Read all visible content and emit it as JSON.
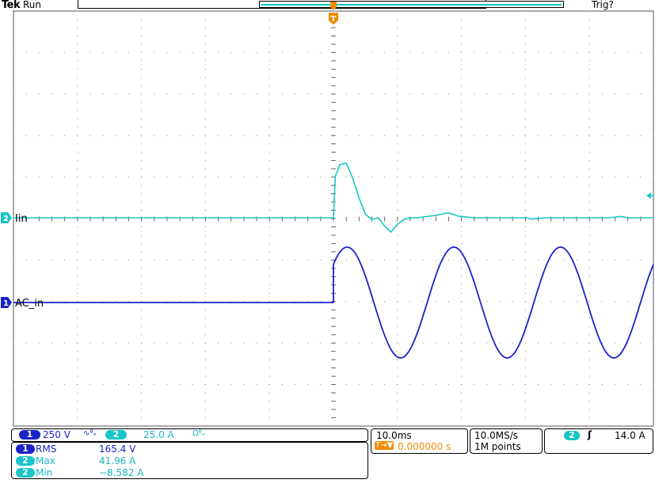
{
  "header": {
    "brand": "Tek",
    "run_state": "Run",
    "trigger_state": "Trig?"
  },
  "trigger_marker_letter": "T",
  "chart_data": {
    "type": "line",
    "title": "",
    "x_unit": "ms",
    "x_range": [
      -50,
      50
    ],
    "trigger_time_ms": 0,
    "grid": true,
    "series": [
      {
        "name": "Iin",
        "channel": 2,
        "color": "#19c5c8",
        "unit": "A",
        "volts_per_div": 25.0,
        "x": [
          -50,
          0,
          0.3,
          1,
          2,
          3,
          4,
          5,
          6,
          7,
          8,
          9,
          10,
          11,
          12,
          13,
          16,
          18,
          19.5,
          22,
          24,
          30,
          31,
          33,
          35,
          43,
          45,
          46,
          48,
          50
        ],
        "y": [
          0,
          0,
          25,
          32,
          33,
          24,
          12,
          2,
          -1,
          0,
          -5,
          -8.58,
          -4,
          -1,
          0,
          0,
          1.5,
          3,
          1,
          0,
          0,
          0,
          -0.8,
          0,
          0,
          0,
          0.8,
          0,
          0,
          0
        ]
      },
      {
        "name": "AC_in",
        "channel": 1,
        "color": "#1a23c8",
        "unit": "V",
        "volts_per_div": 250,
        "x": [
          -50,
          0,
          0,
          50
        ],
        "y": [
          0,
          0,
          240,
          null
        ],
        "note_func": "sine after trigger"
      }
    ],
    "channel_labels": [
      {
        "channel": "2",
        "label": "Iin"
      },
      {
        "channel": "1",
        "label": "AC_in"
      }
    ]
  },
  "status_panel": {
    "ch1_badge": "1",
    "ch1_scale": "250 V",
    "ch1_coupling_glyph": "∿ᴮᵥ",
    "ch2_badge": "2",
    "ch2_scale": "25.0 A",
    "ch2_coupling_glyph": "Ωᴮᵥ"
  },
  "measurements": [
    {
      "badge": "1",
      "name": "RMS",
      "value": "165.4 V"
    },
    {
      "badge": "2",
      "name": "Max",
      "value": "41.96 A"
    },
    {
      "badge": "2",
      "name": "Min",
      "value": "−8.582 A"
    }
  ],
  "timebase": {
    "scale": "10.0ms",
    "trigger_position": "0.000000 s",
    "trigger_glyph": "T→▼"
  },
  "acquisition": {
    "sample_rate": "10.0MS/s",
    "record_length": "1M points"
  },
  "trigger": {
    "source_badge": "2",
    "slope_glyph": "ʃ",
    "level": "14.0 A"
  },
  "colors": {
    "ch1": "#1a23c8",
    "ch2": "#19c5c8",
    "trigger": "#f08c00",
    "grid": "#8c8c8c"
  }
}
